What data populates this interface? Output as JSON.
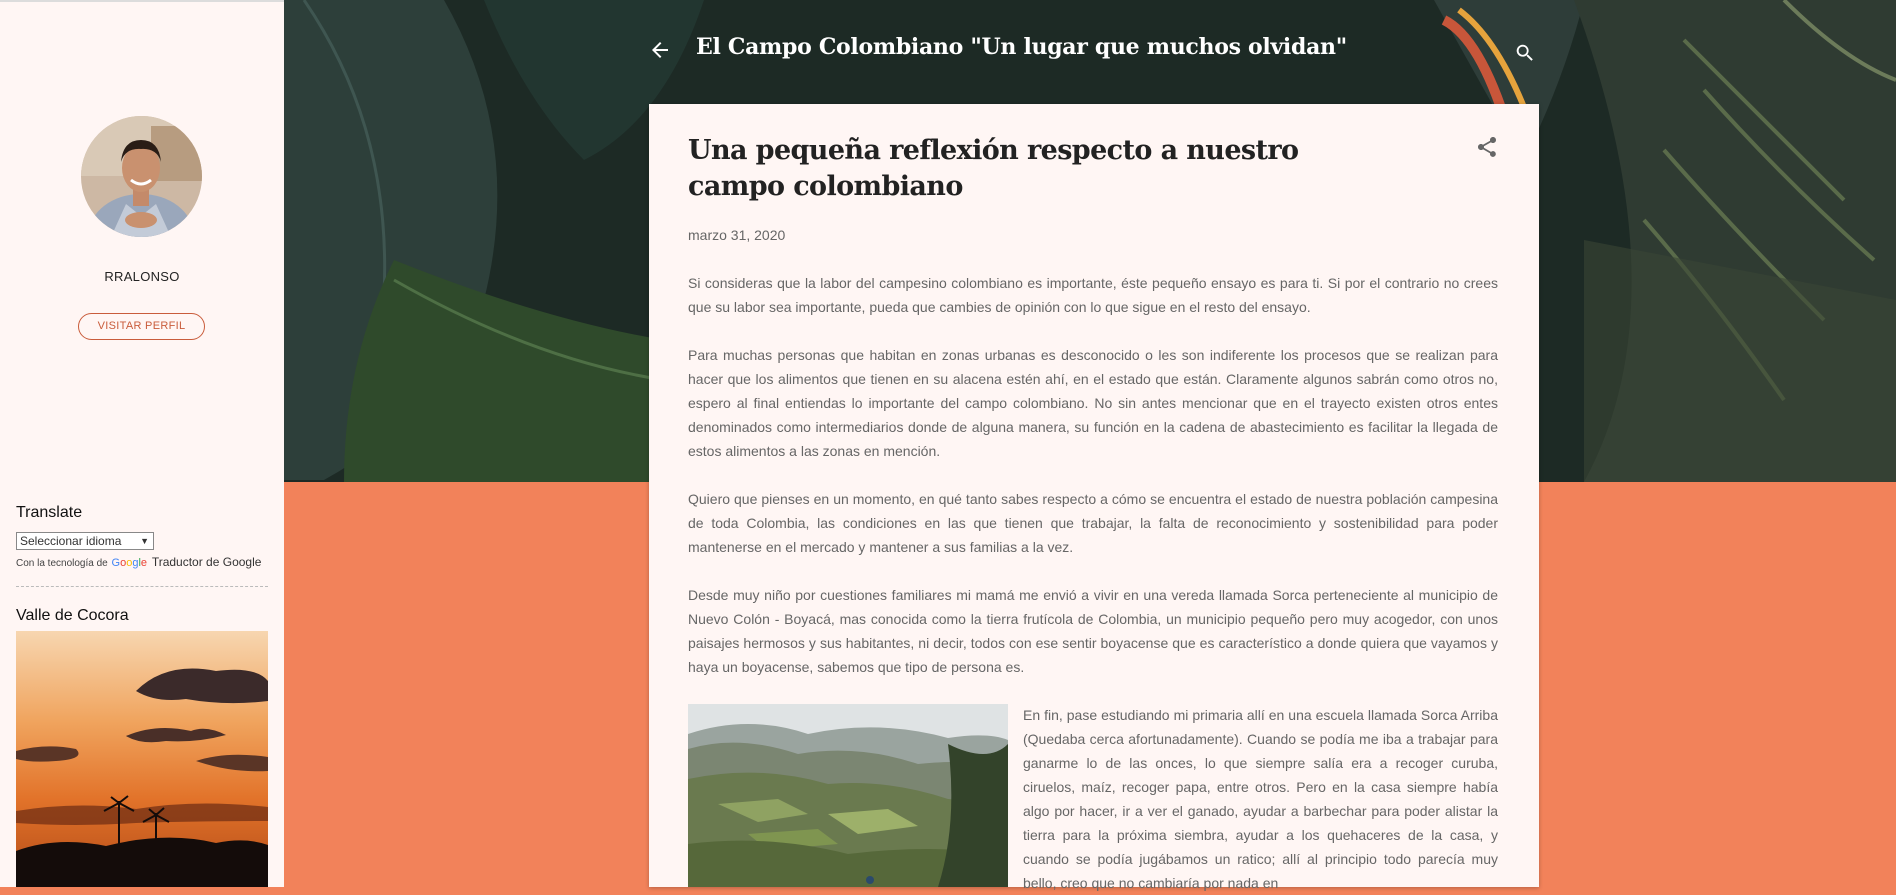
{
  "sidebar": {
    "avatar_alt": "profile photo",
    "profile_name": "RRALONSO",
    "visit_profile_label": "VISITAR PERFIL",
    "translate_title": "Translate",
    "language_select_value": "Seleccionar idioma",
    "powered_by_prefix": "Con la tecnología de",
    "powered_by_google": "Google",
    "powered_by_suffix": "Traductor de Google",
    "cocora_title": "Valle de Cocora"
  },
  "header": {
    "blog_title": "El Campo Colombiano \"Un lugar que muchos olvidan\"",
    "back_icon": "arrow-left-icon",
    "search_icon": "search-icon"
  },
  "post": {
    "title": "Una pequeña reflexión respecto a nuestro campo colombiano",
    "date": "marzo 31, 2020",
    "share_icon": "share-icon",
    "paragraphs": [
      "Si consideras que la labor del campesino colombiano es importante, éste pequeño ensayo es para ti. Si por el contrario no crees que su labor sea importante, pueda que cambies de opinión con lo que sigue en el resto del ensayo.",
      "Para muchas personas que habitan en zonas urbanas es desconocido o les son indiferente los procesos que se realizan para hacer que los alimentos que tienen en su alacena estén ahí, en el estado que están. Claramente algunos sabrán como otros no, espero al final entiendas lo importante del campo colombiano. No sin antes mencionar que en el trayecto existen otros entes denominados como intermediarios donde de alguna manera, su función en la cadena de abastecimiento es facilitar la llegada de estos alimentos a las zonas en mención.",
      "Quiero que pienses en un momento, en qué tanto sabes respecto a cómo se encuentra el estado de nuestra población campesina de toda Colombia, las condiciones en las que tienen que trabajar, la falta de reconocimiento y sostenibilidad para poder mantenerse en el mercado y mantener a sus familias a la vez.",
      "Desde muy niño por cuestiones familiares mi mamá me envió a vivir en una vereda llamada Sorca perteneciente al municipio de Nuevo Colón - Boyacá, mas conocida como la tierra frutícola de Colombia, un municipio pequeño pero muy acogedor, con unos paisajes hermosos y sus habitantes, ni decir, todos con ese sentir boyacense que es característico a donde quiera que vayamos y haya un boyacense, sabemos que tipo de persona es.",
      "En fin, pase estudiando mi primaria allí en una escuela llamada Sorca Arriba (Quedaba cerca afortunadamente). Cuando se podía me iba a trabajar para ganarme lo de las onces, lo que siempre salía era a recoger curuba, ciruelos, maíz, recoger papa, entre otros. Pero en la casa siempre había algo por hacer, ir a ver el ganado, ayudar a barbechar para poder alistar la tierra para la próxima siembra, ayudar a los quehaceres de la casa, y cuando se podía jugábamos un ratico; allí al principio todo parecía muy bello, creo que no cambiaría por nada en"
    ]
  },
  "colors": {
    "accent": "#f2825a",
    "card_bg": "#fff6f4",
    "link_accent": "#c95c3b"
  }
}
